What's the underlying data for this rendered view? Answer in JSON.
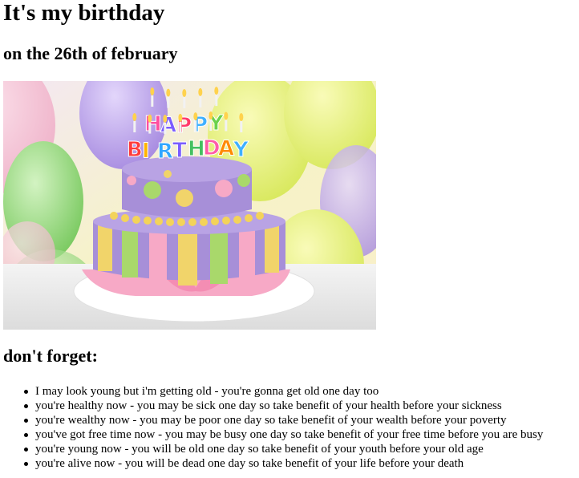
{
  "header": {
    "title": "It's my birthday",
    "subtitle": "on the 26th of february"
  },
  "image": {
    "cake_letters_top": [
      "H",
      "A",
      "P",
      "P",
      "Y"
    ],
    "cake_letters_bottom": [
      "B",
      "I",
      "R",
      "T",
      "H",
      "D",
      "A",
      "Y"
    ],
    "letter_colors_top": [
      "#ff4fa0",
      "#7a5cff",
      "#ff3b6b",
      "#3fb0ff",
      "#6ad14c"
    ],
    "letter_colors_bottom": [
      "#ff3b3b",
      "#ffb400",
      "#2fa6ff",
      "#7a5cff",
      "#44c060",
      "#ff5ca8",
      "#ff8a00",
      "#3fb0ff"
    ],
    "colors": {
      "cake_purple": "#a78fd8",
      "cake_yellow": "#f1d46a",
      "cake_green": "#a9d86b",
      "cake_pink": "#f7a9c6",
      "balloon_yellow": "#e6ef7a",
      "balloon_purple": "#b89be8",
      "balloon_green": "#8fd47a"
    }
  },
  "section": {
    "heading": "don't forget:"
  },
  "reminders": [
    "I may look young but i'm getting old - you're gonna get old one day too",
    "you're healthy now - you may be sick one day so take benefit of your health before your sickness",
    "you're wealthy now - you may be poor one day so take benefit of your wealth before your poverty",
    "you've got free time now - you may be busy one day so take benefit of your free time before you are busy",
    "you're young now - you will be old one day so take benefit of your youth before your old age",
    "you're alive now - you will be dead one day so take benefit of your life before your death"
  ]
}
